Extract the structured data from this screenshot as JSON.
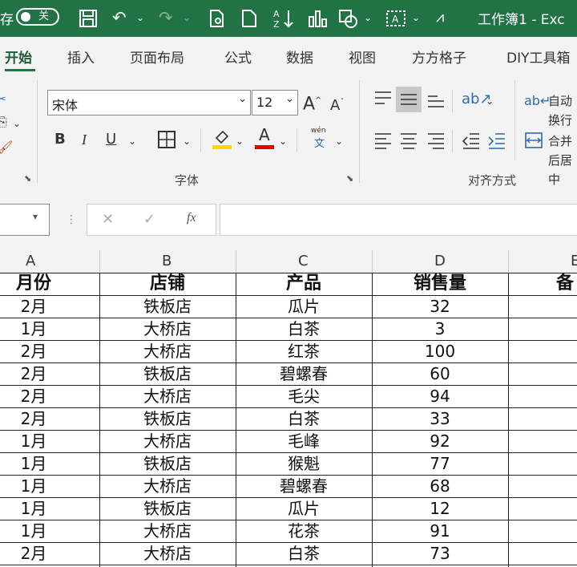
{
  "title_bar": {
    "save_prefix": "存",
    "autosave_state": "关",
    "doc_title": "工作簿1 - Exc"
  },
  "tabs": [
    "开始",
    "插入",
    "页面布局",
    "公式",
    "数据",
    "视图",
    "方方格子",
    "DIY工具箱"
  ],
  "ribbon": {
    "font_name": "宋体",
    "font_size": "12",
    "bold": "B",
    "italic": "I",
    "underline": "U",
    "font_group_label": "字体",
    "align_group_label": "对齐方式",
    "wrap_text": "自动换行",
    "merge_center": "合并后居中",
    "phonetic_top": "wén",
    "phonetic_bottom": "文",
    "grow_font": "A",
    "shrink_font": "A",
    "font_color_letter": "A"
  },
  "formula_bar": {
    "fx_label": "fx",
    "cancel": "✕",
    "enter": "✓"
  },
  "columns": [
    "A",
    "B",
    "C",
    "D",
    "E"
  ],
  "table": {
    "headers": [
      "月份",
      "店铺",
      "产品",
      "销售量",
      "备"
    ],
    "rows": [
      [
        "2月",
        "铁板店",
        "瓜片",
        "32"
      ],
      [
        "1月",
        "大桥店",
        "白茶",
        "3"
      ],
      [
        "2月",
        "大桥店",
        "红茶",
        "100"
      ],
      [
        "2月",
        "铁板店",
        "碧螺春",
        "60"
      ],
      [
        "2月",
        "大桥店",
        "毛尖",
        "94"
      ],
      [
        "2月",
        "铁板店",
        "白茶",
        "33"
      ],
      [
        "1月",
        "大桥店",
        "毛峰",
        "92"
      ],
      [
        "1月",
        "铁板店",
        "猴魁",
        "77"
      ],
      [
        "1月",
        "大桥店",
        "碧螺春",
        "68"
      ],
      [
        "1月",
        "铁板店",
        "瓜片",
        "12"
      ],
      [
        "1月",
        "大桥店",
        "花茶",
        "91"
      ],
      [
        "2月",
        "大桥店",
        "白茶",
        "73"
      ]
    ]
  },
  "colors": {
    "title_bar": "#217346",
    "ribbon_bg": "#f3f3f3",
    "font_color_bar": "#e00000",
    "highlight_bar": "#ffd800"
  }
}
